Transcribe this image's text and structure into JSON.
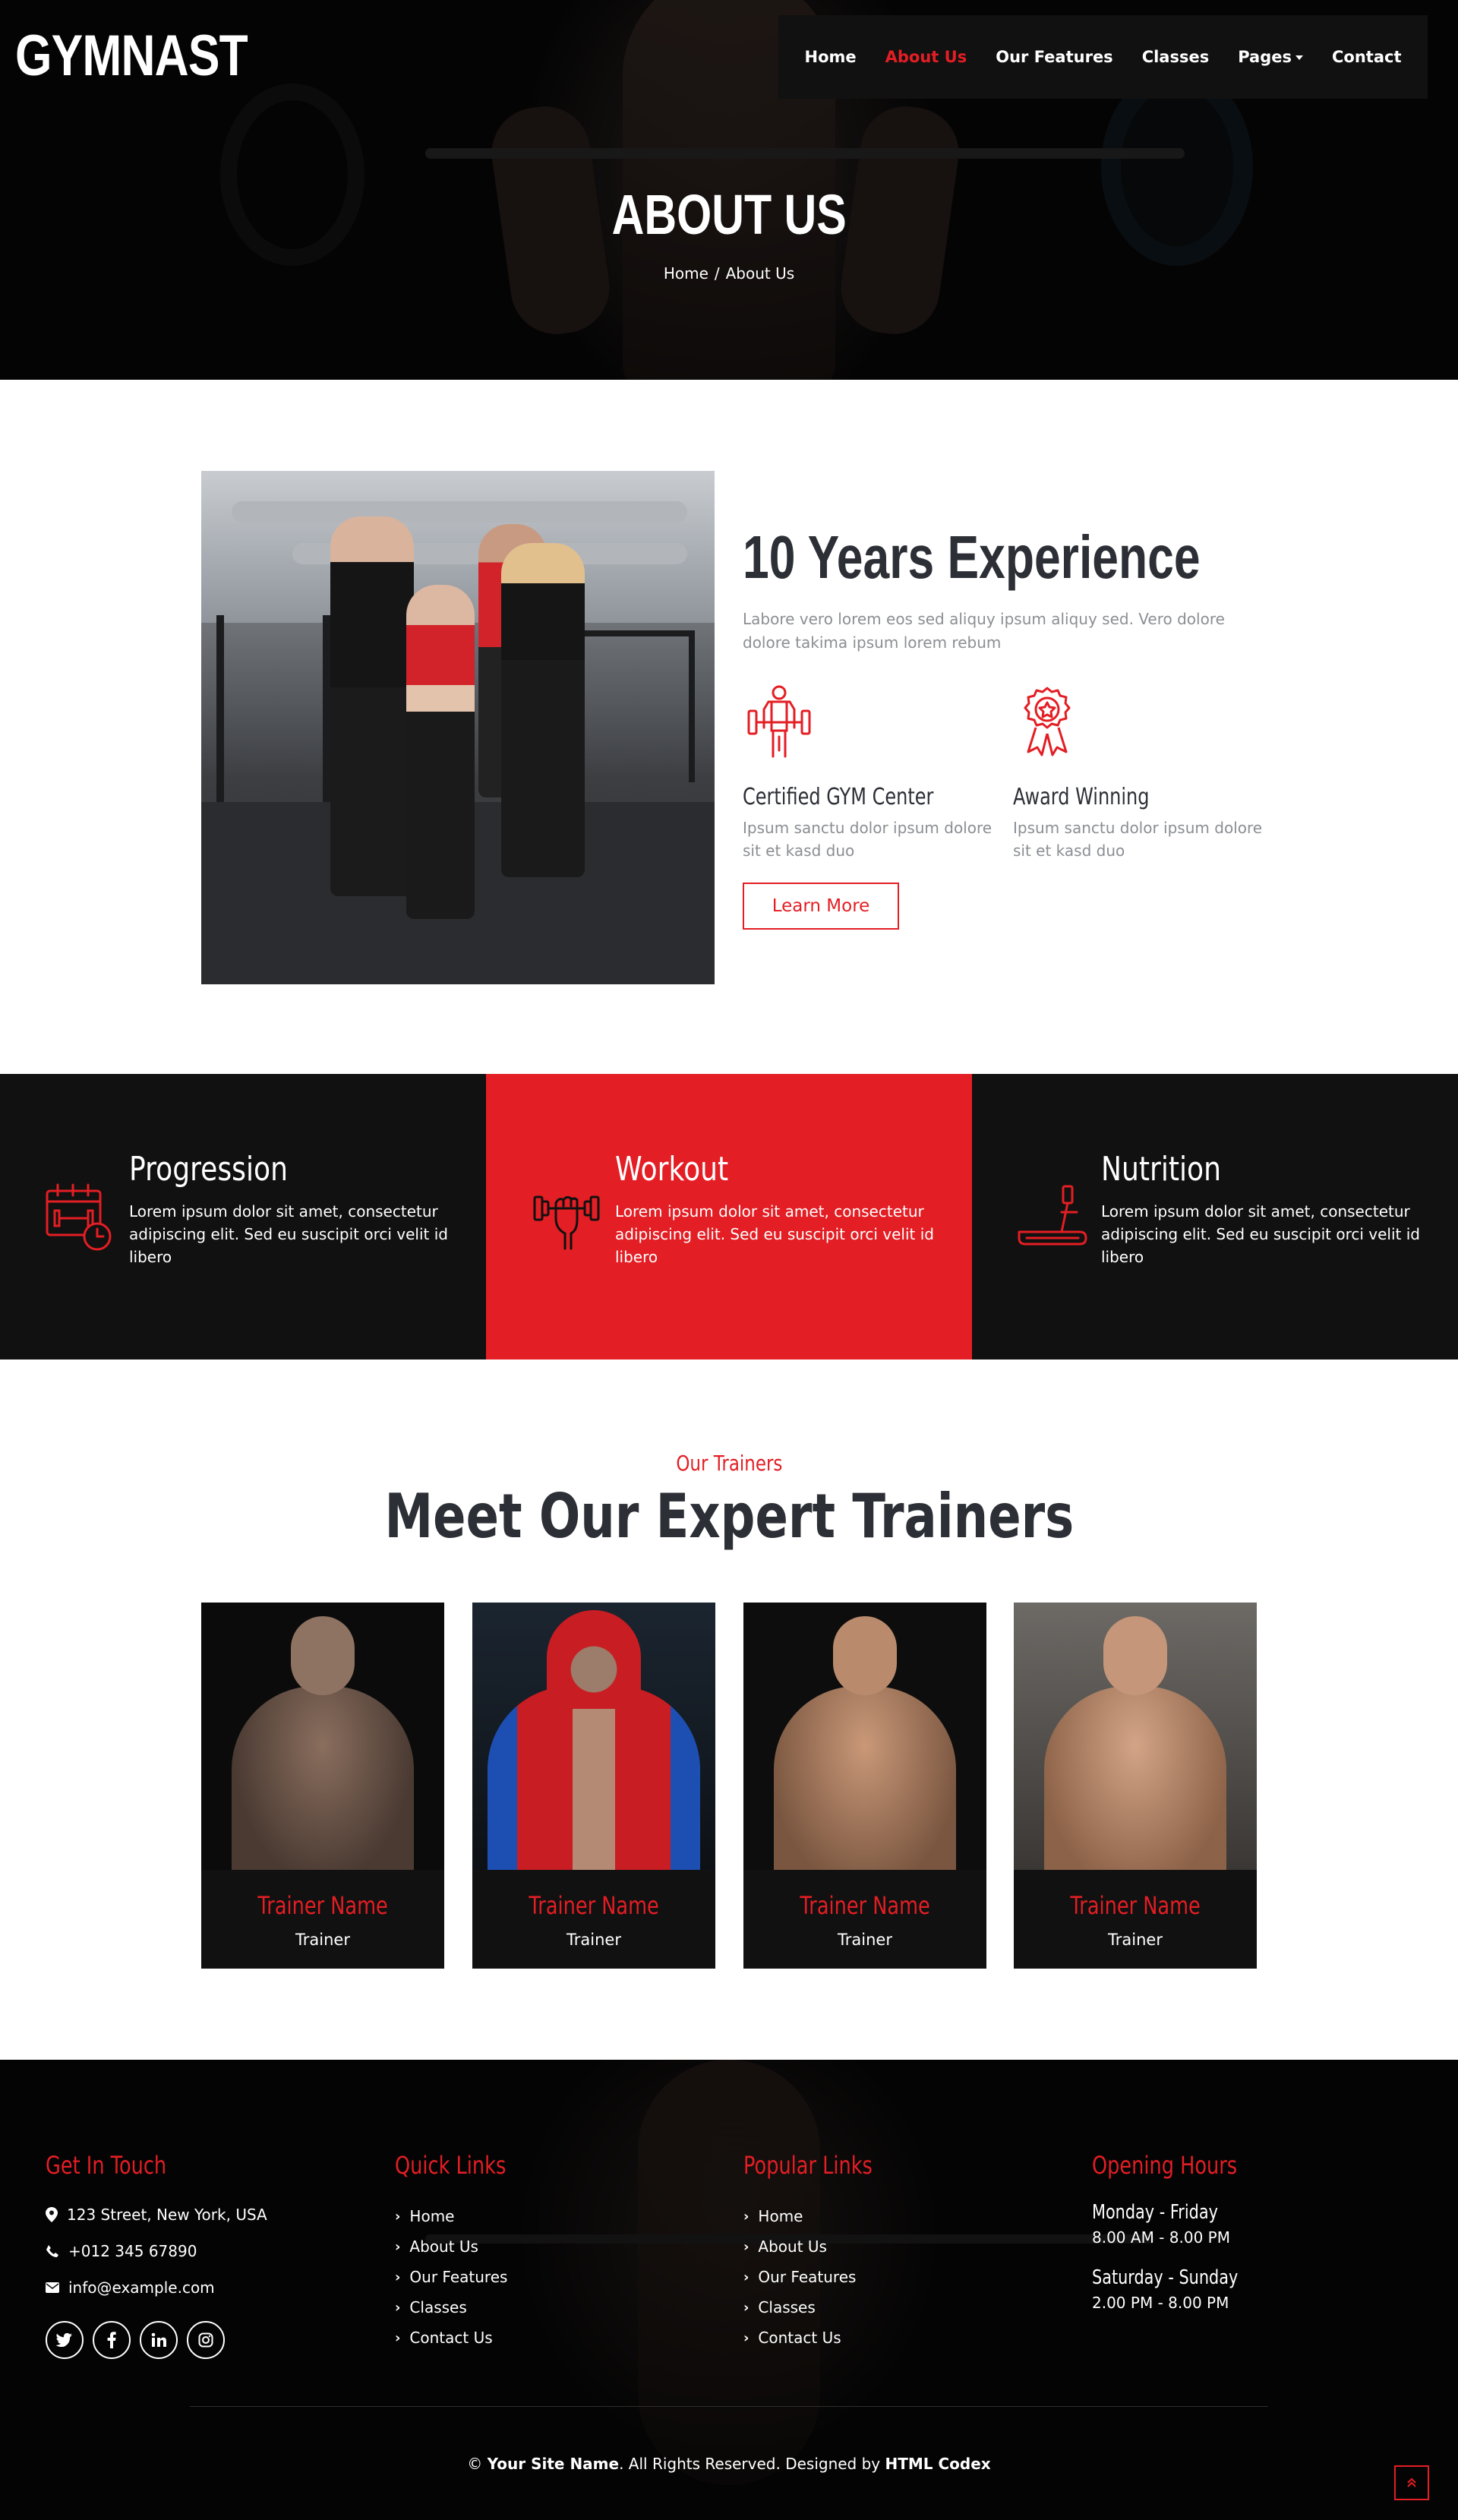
{
  "brand": "GYMNAST",
  "nav": {
    "items": [
      "Home",
      "About Us",
      "Our Features",
      "Classes",
      "Pages",
      "Contact"
    ],
    "active_index": 1
  },
  "hero": {
    "title": "ABOUT US",
    "breadcrumb": [
      "Home",
      "About Us"
    ],
    "breadcrumb_separator": "/"
  },
  "about": {
    "title": "10 Years Experience",
    "text": "Labore vero lorem eos sed aliquy ipsum aliquy sed. Vero dolore dolore takima ipsum lorem rebum",
    "features": [
      {
        "title": "Certified GYM Center",
        "text": "Ipsum sanctu dolor ipsum dolore sit et kasd duo",
        "icon": "weightlifter-icon"
      },
      {
        "title": "Award Winning",
        "text": "Ipsum sanctu dolor ipsum dolore sit et kasd duo",
        "icon": "award-medal-icon"
      }
    ],
    "button": "Learn More"
  },
  "band": [
    {
      "title": "Progression",
      "text": "Lorem ipsum dolor sit amet, consectetur adipiscing elit. Sed eu suscipit orci velit id libero",
      "icon": "calendar-dumbbell-icon",
      "bg": "#111111"
    },
    {
      "title": "Workout",
      "text": "Lorem ipsum dolor sit amet, consectetur adipiscing elit. Sed eu suscipit orci velit id libero",
      "icon": "hand-dumbbell-icon",
      "bg": "#e31e24"
    },
    {
      "title": "Nutrition",
      "text": "Lorem ipsum dolor sit amet, consectetur adipiscing elit. Sed eu suscipit orci velit id libero",
      "icon": "treadmill-icon",
      "bg": "#111111"
    }
  ],
  "trainers": {
    "subtitle": "Our Trainers",
    "title": "Meet Our Expert Trainers",
    "items": [
      {
        "name": "Trainer Name",
        "role": "Trainer"
      },
      {
        "name": "Trainer Name",
        "role": "Trainer"
      },
      {
        "name": "Trainer Name",
        "role": "Trainer"
      },
      {
        "name": "Trainer Name",
        "role": "Trainer"
      }
    ]
  },
  "footer": {
    "contact": {
      "title": "Get In Touch",
      "address": "123 Street, New York, USA",
      "phone": "+012 345 67890",
      "email": "info@example.com"
    },
    "socials": [
      "twitter-icon",
      "facebook-icon",
      "linkedin-icon",
      "instagram-icon"
    ],
    "quick_links": {
      "title": "Quick Links",
      "items": [
        "Home",
        "About Us",
        "Our Features",
        "Classes",
        "Contact Us"
      ]
    },
    "popular_links": {
      "title": "Popular Links",
      "items": [
        "Home",
        "About Us",
        "Our Features",
        "Classes",
        "Contact Us"
      ]
    },
    "hours": {
      "title": "Opening Hours",
      "weekdays": "Monday - Friday",
      "weekdays_time": "8.00 AM - 8.00 PM",
      "weekend": "Saturday - Sunday",
      "weekend_time": "2.00 PM - 8.00 PM"
    },
    "copyright": {
      "prefix": "©",
      "site": "Your Site Name",
      "middle": ". All Rights Reserved. Designed by",
      "designer": "HTML Codex"
    }
  },
  "colors": {
    "accent": "#e31e24",
    "dark": "#111111",
    "heading": "#2c2f35"
  }
}
